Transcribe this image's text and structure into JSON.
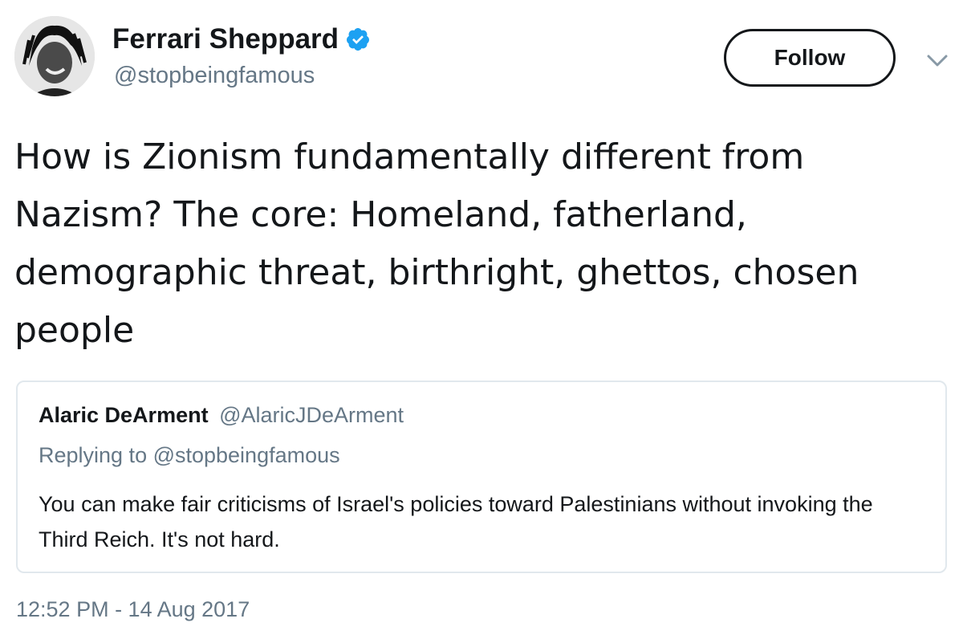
{
  "author": {
    "display_name": "Ferrari Sheppard",
    "handle": "@stopbeingfamous",
    "verified": true,
    "avatar": "profile-photo"
  },
  "actions": {
    "follow_label": "Follow",
    "more_icon": "chevron-down-icon"
  },
  "tweet": {
    "text": "How is Zionism fundamentally different from Nazism? The core: Homeland, fatherland, demographic threat, birthright, ghettos, chosen people",
    "timestamp": "12:52 PM - 14 Aug 2017"
  },
  "quoted_tweet": {
    "display_name": "Alaric DeArment",
    "handle": "@AlaricJDeArment",
    "replying_to": "Replying to @stopbeingfamous",
    "text": "You can make fair criticisms of Israel's policies toward Palestinians without invoking the Third Reich. It's not hard."
  },
  "colors": {
    "text_primary": "#14171a",
    "text_secondary": "#657786",
    "verified_blue": "#1da1f2",
    "card_border": "#e1e8ed"
  }
}
